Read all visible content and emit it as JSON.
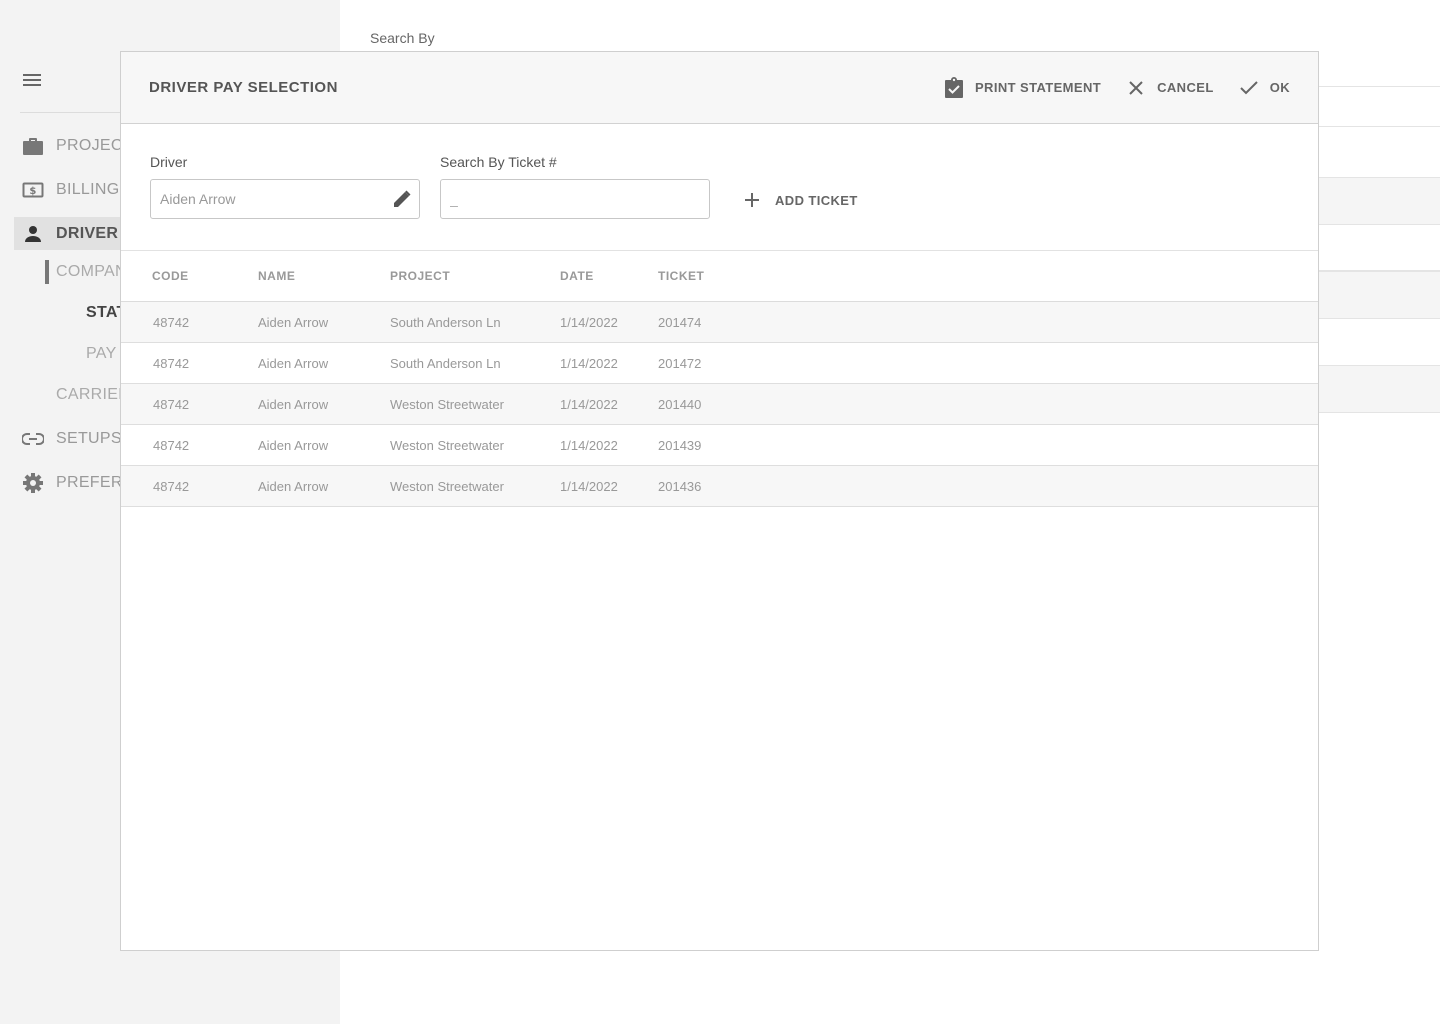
{
  "sidebar": {
    "items": [
      {
        "label": "PROJECT",
        "icon": "briefcase-icon"
      },
      {
        "label": "BILLING",
        "icon": "billing-icon"
      },
      {
        "label": "DRIVER I",
        "icon": "person-icon"
      },
      {
        "label": "COMPAN",
        "icon": ""
      },
      {
        "label": "STAT",
        "icon": ""
      },
      {
        "label": "PAY I",
        "icon": ""
      },
      {
        "label": "CARRIER",
        "icon": ""
      },
      {
        "label": "SETUPS",
        "icon": "link-icon"
      },
      {
        "label": "PREFERI",
        "icon": "gear-icon"
      }
    ]
  },
  "background": {
    "search_label": "Search By"
  },
  "modal": {
    "title": "DRIVER PAY SELECTION",
    "actions": {
      "print_label": "PRINT STATEMENT",
      "cancel_label": "CANCEL",
      "ok_label": "OK"
    },
    "driver": {
      "label": "Driver",
      "value": "Aiden Arrow"
    },
    "ticket_search": {
      "label": "Search By Ticket #",
      "placeholder": "_"
    },
    "add_ticket_label": "ADD TICKET",
    "table": {
      "columns": [
        "CODE",
        "NAME",
        "PROJECT",
        "DATE",
        "TICKET"
      ],
      "rows": [
        {
          "code": "48742",
          "name": "Aiden Arrow",
          "project": "South Anderson Ln",
          "date": "1/14/2022",
          "ticket": "201474"
        },
        {
          "code": "48742",
          "name": "Aiden Arrow",
          "project": "South Anderson Ln",
          "date": "1/14/2022",
          "ticket": "201472"
        },
        {
          "code": "48742",
          "name": "Aiden Arrow",
          "project": "Weston Streetwater",
          "date": "1/14/2022",
          "ticket": "201440"
        },
        {
          "code": "48742",
          "name": "Aiden Arrow",
          "project": "Weston Streetwater",
          "date": "1/14/2022",
          "ticket": "201439"
        },
        {
          "code": "48742",
          "name": "Aiden Arrow",
          "project": "Weston Streetwater",
          "date": "1/14/2022",
          "ticket": "201436"
        }
      ]
    }
  },
  "colors": {
    "sidebar_bg": "#f3f3f3",
    "header_bg": "#f7f7f7",
    "active_nav_bg": "#e1e1e1",
    "alt_row_bg": "#f7f7f7"
  }
}
